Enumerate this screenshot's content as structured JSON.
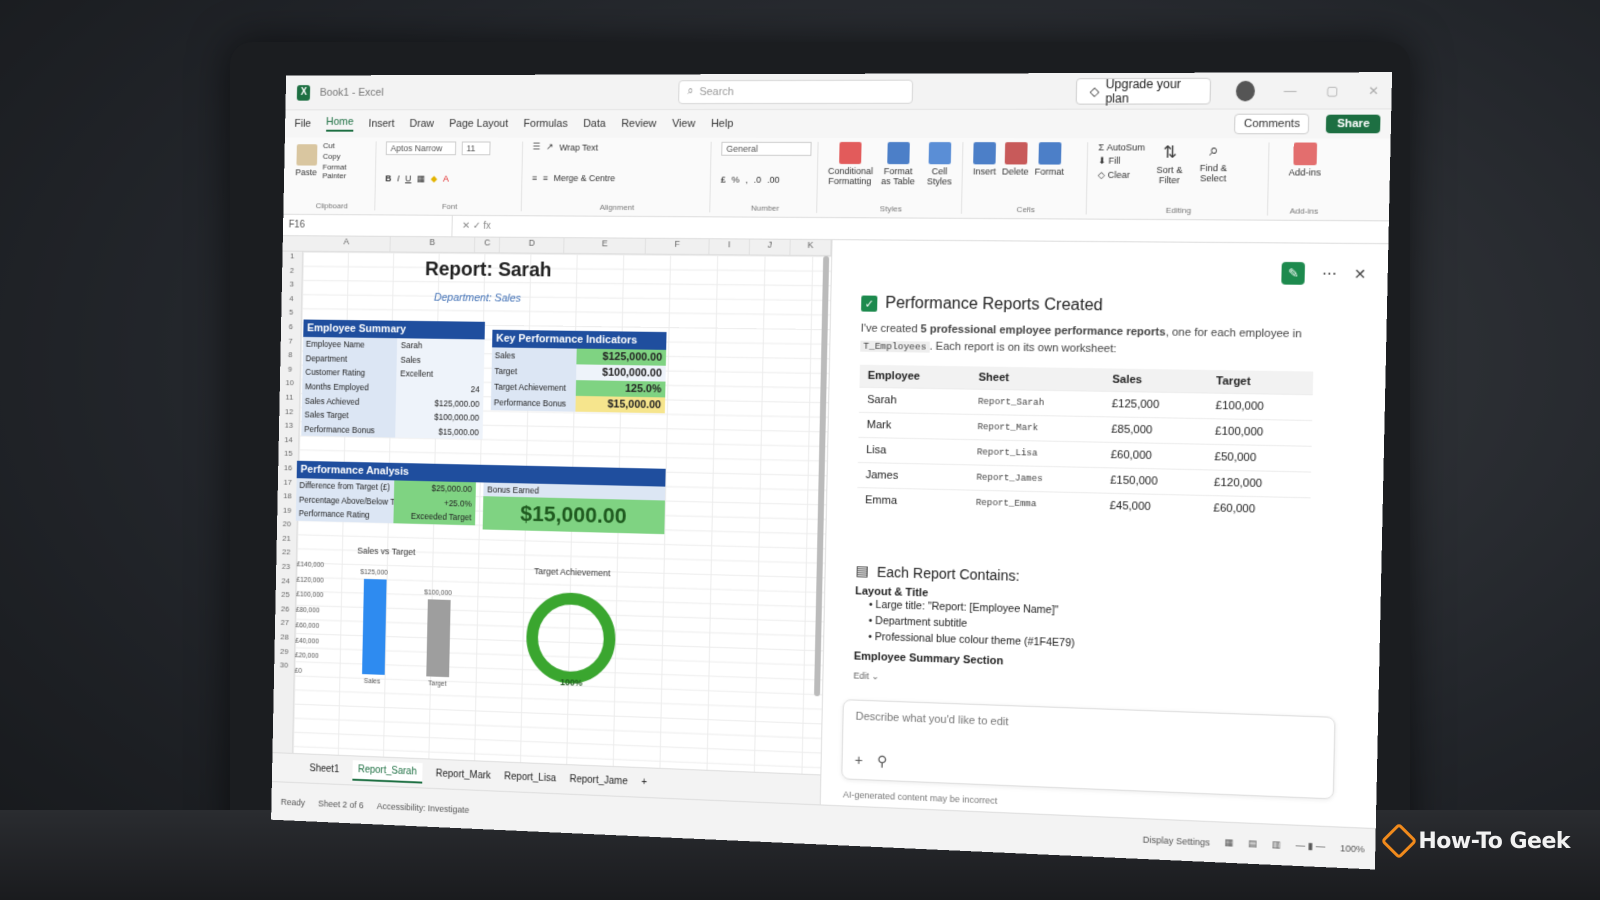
{
  "window": {
    "title": "Book1 - Excel",
    "search_placeholder": "Search",
    "upgrade_label": "Upgrade your plan"
  },
  "menu": [
    "File",
    "Home",
    "Insert",
    "Draw",
    "Page Layout",
    "Formulas",
    "Data",
    "Review",
    "View",
    "Help"
  ],
  "menu_active": "Home",
  "comments_label": "Comments",
  "share_label": "Share",
  "ribbon": {
    "clipboard": {
      "paste": "Paste",
      "cut": "Cut",
      "copy": "Copy",
      "format_painter": "Format Painter",
      "label": "Clipboard"
    },
    "font": {
      "name": "Aptos Narrow",
      "size": "11",
      "label": "Font"
    },
    "alignment": {
      "wrap": "Wrap Text",
      "merge": "Merge & Centre",
      "label": "Alignment"
    },
    "number": {
      "format": "General",
      "label": "Number"
    },
    "styles": {
      "conditional": "Conditional Formatting",
      "table": "Format as Table",
      "cell": "Cell Styles",
      "label": "Styles"
    },
    "cells": {
      "insert": "Insert",
      "delete": "Delete",
      "format": "Format",
      "label": "Cells"
    },
    "editing": {
      "autosum": "AutoSum",
      "fill": "Fill",
      "clear": "Clear",
      "sort": "Sort & Filter",
      "find": "Find & Select",
      "label": "Editing"
    },
    "addins": {
      "label_btn": "Add-ins",
      "label": "Add-ins"
    }
  },
  "namebox": "F16",
  "columns": [
    "A",
    "B",
    "C",
    "D",
    "E",
    "F",
    "I",
    "J",
    "K"
  ],
  "rows": [
    "1",
    "2",
    "3",
    "4",
    "5",
    "6",
    "7",
    "8",
    "9",
    "10",
    "11",
    "12",
    "13",
    "14",
    "15",
    "16",
    "17",
    "18",
    "19",
    "20",
    "21",
    "22",
    "23",
    "24",
    "25",
    "26",
    "27",
    "28",
    "29",
    "30"
  ],
  "report": {
    "title": "Report: Sarah",
    "department": "Department: Sales",
    "employee_summary": {
      "heading": "Employee Summary",
      "rows": [
        {
          "k": "Employee Name",
          "v": "Sarah"
        },
        {
          "k": "Department",
          "v": "Sales"
        },
        {
          "k": "Customer Rating",
          "v": "Excellent"
        },
        {
          "k": "Months Employed",
          "v": "24"
        },
        {
          "k": "Sales Achieved",
          "v": "$125,000.00"
        },
        {
          "k": "Sales Target",
          "v": "$100,000.00"
        },
        {
          "k": "Performance Bonus",
          "v": "$15,000.00"
        }
      ]
    },
    "kpi": {
      "heading": "Key Performance Indicators",
      "rows": [
        {
          "k": "Sales",
          "v": "$125,000.00",
          "color": "#7fd382"
        },
        {
          "k": "Target",
          "v": "$100,000.00",
          "color": "#eef3fa"
        },
        {
          "k": "Target Achievement",
          "v": "125.0%",
          "color": "#7fd382"
        },
        {
          "k": "Performance Bonus",
          "v": "$15,000.00",
          "color": "#f6e58d"
        }
      ]
    },
    "perf": {
      "heading": "Performance Analysis",
      "rows": [
        {
          "k": "Difference from Target (£)",
          "v": "$25,000.00"
        },
        {
          "k": "Percentage Above/Below Tar",
          "v": "+25.0%"
        },
        {
          "k": "Performance Rating",
          "v": "Exceeded Target"
        }
      ],
      "bonus_label": "Bonus Earned",
      "bonus_value": "$15,000.00"
    }
  },
  "chart_data": [
    {
      "type": "bar",
      "title": "Sales vs Target",
      "categories": [
        "Sales",
        "Target"
      ],
      "values": [
        125000,
        100000
      ],
      "data_labels": [
        "$125,000",
        "$100,000"
      ],
      "colors": [
        "#2e8bf0",
        "#9e9e9e"
      ],
      "ylim": [
        0,
        140000
      ],
      "yticks": [
        "£140,000",
        "£120,000",
        "£100,000",
        "£80,000",
        "£60,000",
        "£40,000",
        "£20,000",
        "£0"
      ]
    },
    {
      "type": "pie",
      "title": "Target Achievement",
      "values": [
        100
      ],
      "label": "100%",
      "color": "#3aa62f"
    }
  ],
  "tabs": [
    "Sheet1",
    "Report_Sarah",
    "Report_Mark",
    "Report_Lisa",
    "Report_Jame"
  ],
  "active_tab": "Report_Sarah",
  "copilot": {
    "heading": "Performance Reports Created",
    "desc_pre": "I've created",
    "desc_bold": "5 professional employee performance reports",
    "desc_mid": ", one for each employee in",
    "desc_code": "T_Employees",
    "desc_post": ". Each report is on its own worksheet:",
    "table_headers": [
      "Employee",
      "Sheet",
      "Sales",
      "Target"
    ],
    "table_rows": [
      [
        "Sarah",
        "Report_Sarah",
        "£125,000",
        "£100,000"
      ],
      [
        "Mark",
        "Report_Mark",
        "£85,000",
        "£100,000"
      ],
      [
        "Lisa",
        "Report_Lisa",
        "£60,000",
        "£50,000"
      ],
      [
        "James",
        "Report_James",
        "£150,000",
        "£120,000"
      ],
      [
        "Emma",
        "Report_Emma",
        "£45,000",
        "£60,000"
      ]
    ],
    "contains_heading": "Each Report Contains:",
    "layout_heading": "Layout & Title",
    "bullets": [
      "Large title: \"Report: [Employee Name]\"",
      "Department subtitle",
      "Professional blue colour theme (#1F4E79)"
    ],
    "summary_heading": "Employee Summary Section",
    "edit_chip": "Edit",
    "prompt_placeholder": "Describe what you'd like to edit",
    "disclaimer": "AI-generated content may be incorrect"
  },
  "status": {
    "ready": "Ready",
    "sheet_count": "Sheet 2 of 6",
    "accessibility": "Accessibility: Investigate",
    "display": "Display Settings",
    "zoom": "100%"
  },
  "watermark": "How-To Geek"
}
